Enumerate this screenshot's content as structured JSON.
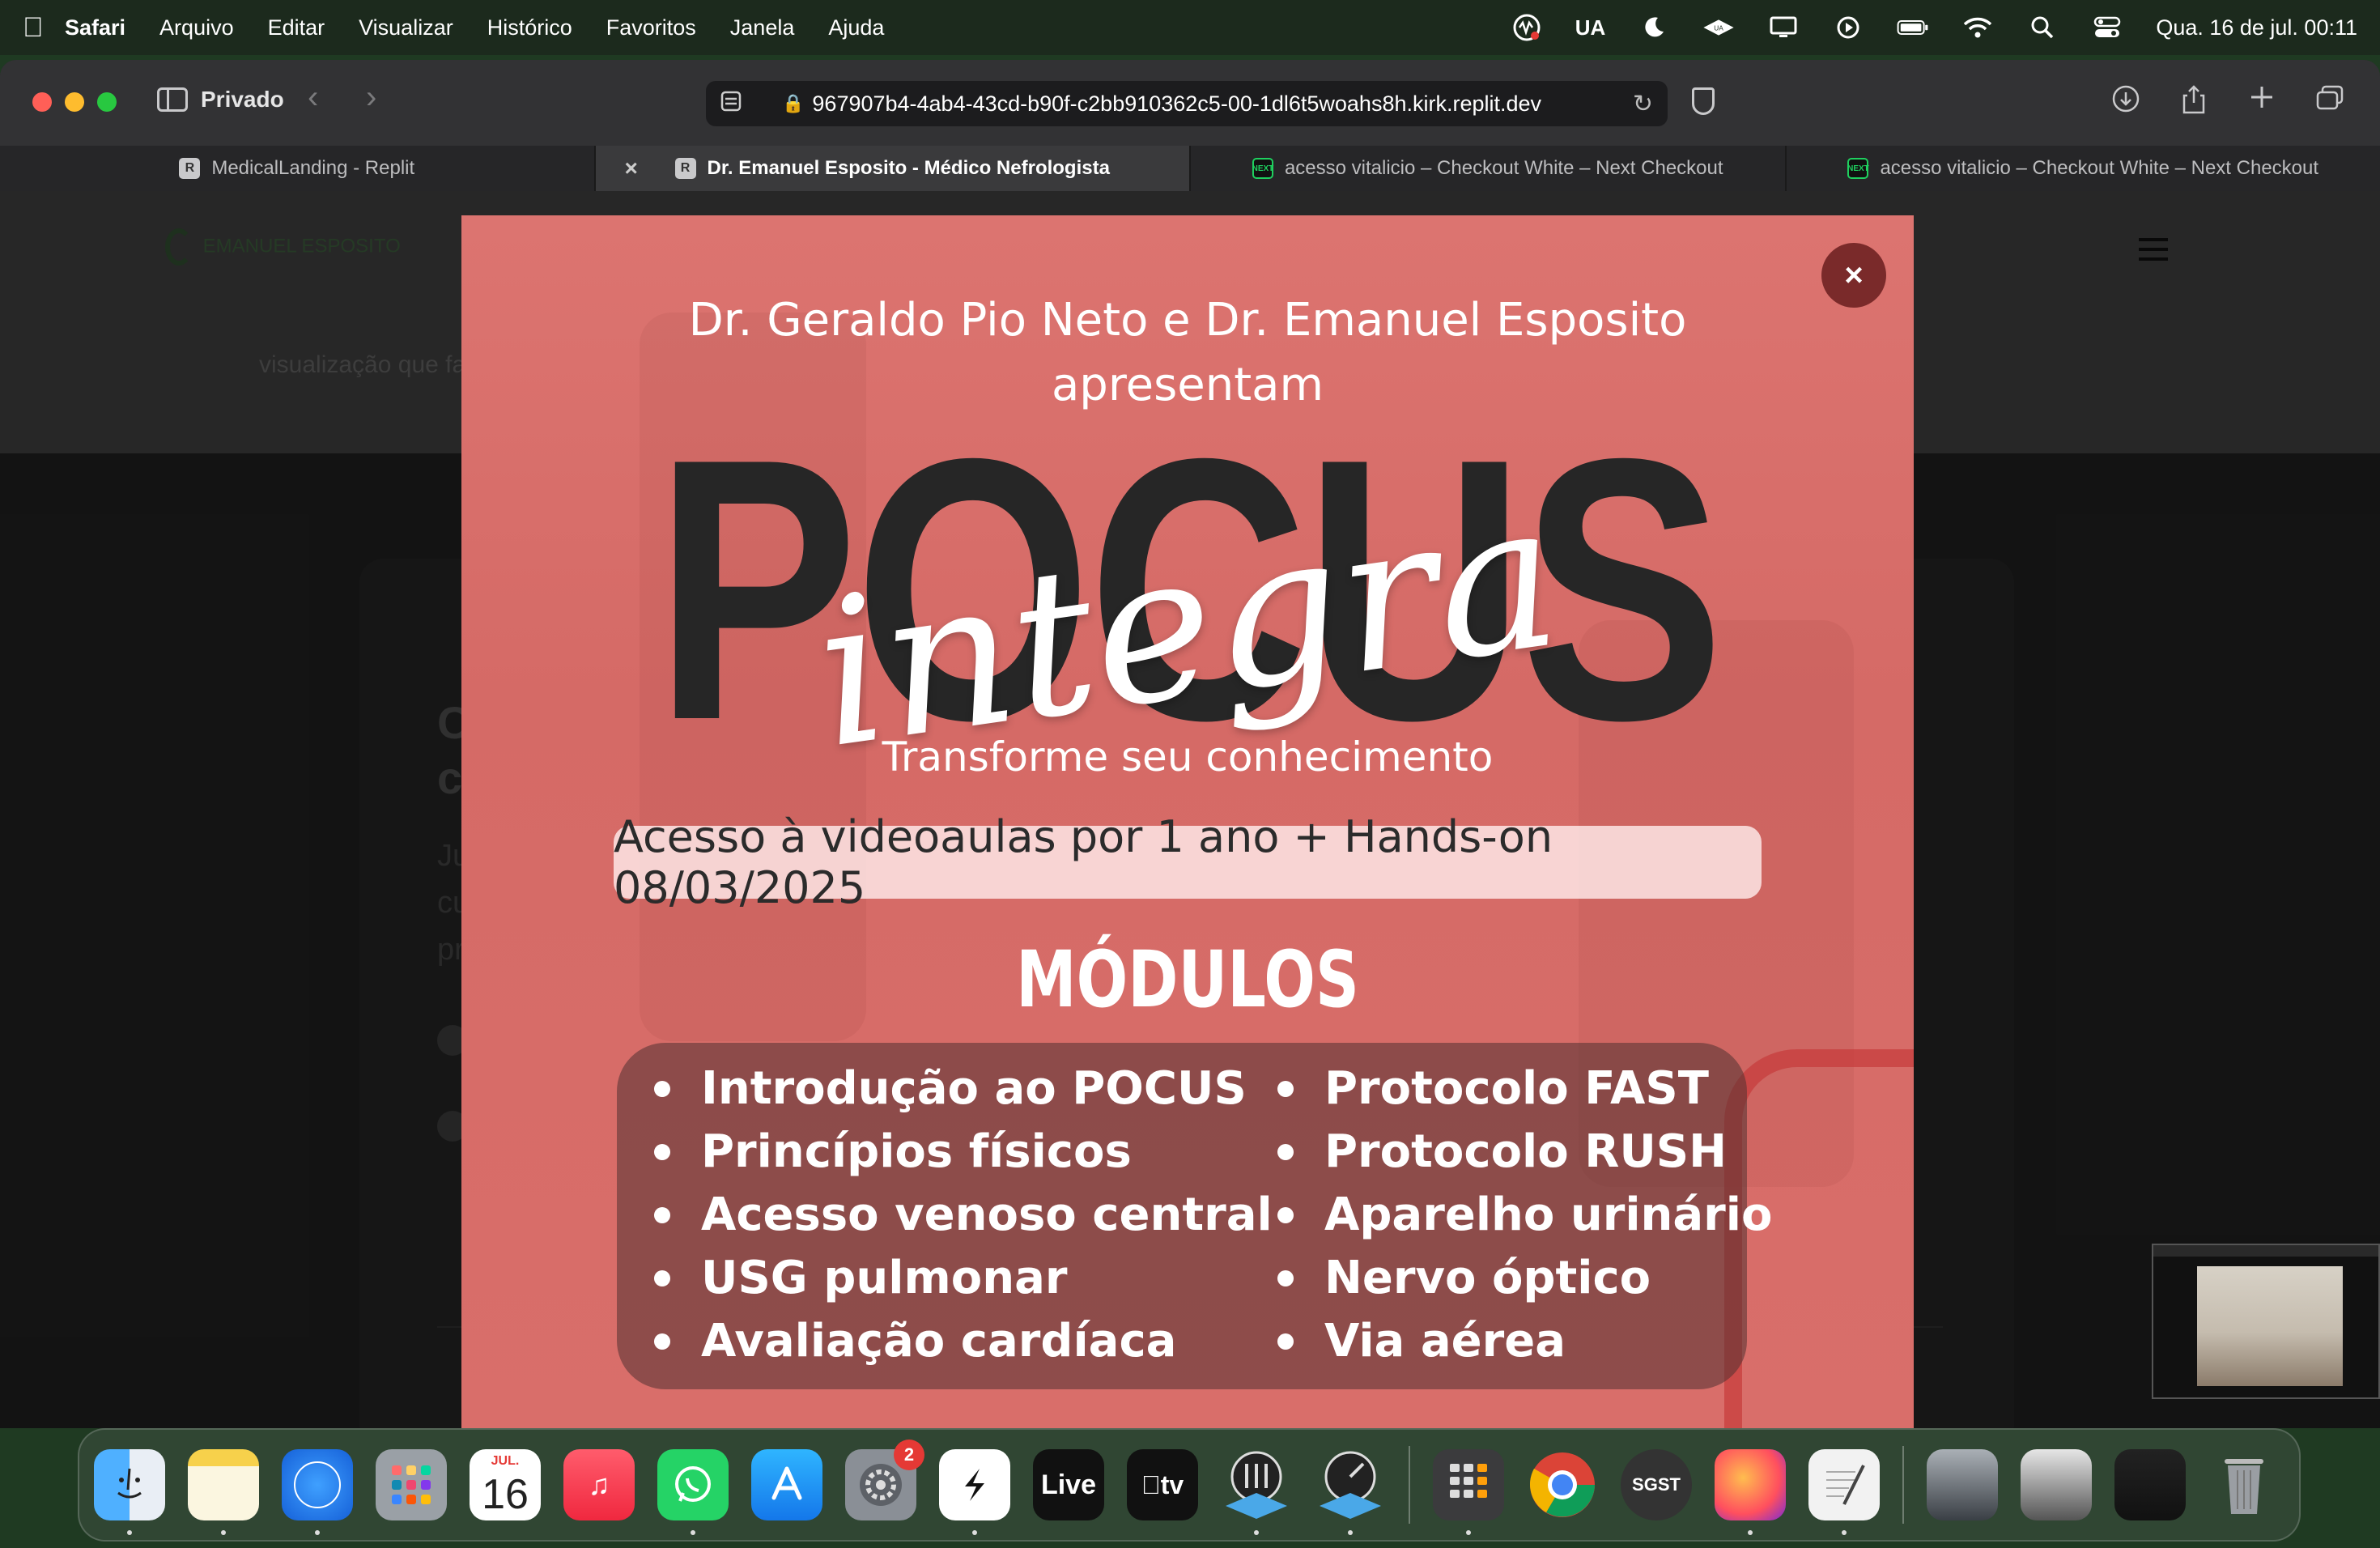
{
  "menubar": {
    "app_name": "Safari",
    "menus": [
      "Arquivo",
      "Editar",
      "Visualizar",
      "Histórico",
      "Favoritos",
      "Janela",
      "Ajuda"
    ],
    "input_source": "UA",
    "clock": "Qua. 16 de jul.  00:11",
    "status_icons": [
      "wave-icon",
      "moon-icon",
      "vpn-icon",
      "display-icon",
      "play-icon",
      "battery-icon",
      "wifi-icon",
      "search-icon",
      "control-center-icon"
    ]
  },
  "browser": {
    "private_label": "Privado",
    "url": "967907b4-4ab4-43cd-b90f-c2bb910362c5-00-1dl6t5woahs8h.kirk.replit.dev",
    "tabs": [
      {
        "title": "MedicalLanding - Replit",
        "favicon": "R",
        "active": false
      },
      {
        "title": "Dr. Emanuel Esposito - Médico Nefrologista",
        "favicon": "R",
        "active": true
      },
      {
        "title": "acesso vitalicio – Checkout White – Next Checkout",
        "favicon": "NEXT",
        "active": false
      },
      {
        "title": "acesso vitalicio – Checkout White – Next Checkout",
        "favicon": "NEXT",
        "active": false
      }
    ]
  },
  "page": {
    "logo_text": "EMANUEL ESPOSITO",
    "subtitle_partial": "visualização que fa"
  },
  "modal": {
    "close_label": "×",
    "presenters_line1": "Dr. Geraldo Pio Neto e Dr. Emanuel Esposito",
    "presenters_line2": "apresentam",
    "brand": "POCUS",
    "brand_script": "integra",
    "tagline": "Transforme seu conhecimento",
    "access": "Acesso à videoaulas por 1 ano + Hands-on 08/03/2025",
    "modules_title": "MÓDULOS",
    "modules_left": [
      "Introdução ao POCUS",
      "Princípios físicos",
      "Acesso venoso central",
      "USG pulmonar",
      "Avaliação cardíaca"
    ],
    "modules_right": [
      "Protocolo FAST",
      "Protocolo RUSH",
      "Aparelho urinário",
      "Nervo óptico",
      "Via aérea"
    ]
  },
  "dock": {
    "items": [
      "Finder",
      "Notes",
      "Safari",
      "Launchpad",
      "Calendar",
      "Music",
      "WhatsApp",
      "App Store",
      "System Settings",
      "Shortcut",
      "Live",
      "Apple TV",
      "UA Mixer",
      "UA Connect",
      "Calculator",
      "Chrome",
      "SGST",
      "Firefox",
      "TextEdit"
    ],
    "calendar_month": "JUL.",
    "calendar_day": "16",
    "settings_badge": "2",
    "live_label": "Live",
    "tv_label": "tv",
    "sgst_label": "SGST"
  }
}
